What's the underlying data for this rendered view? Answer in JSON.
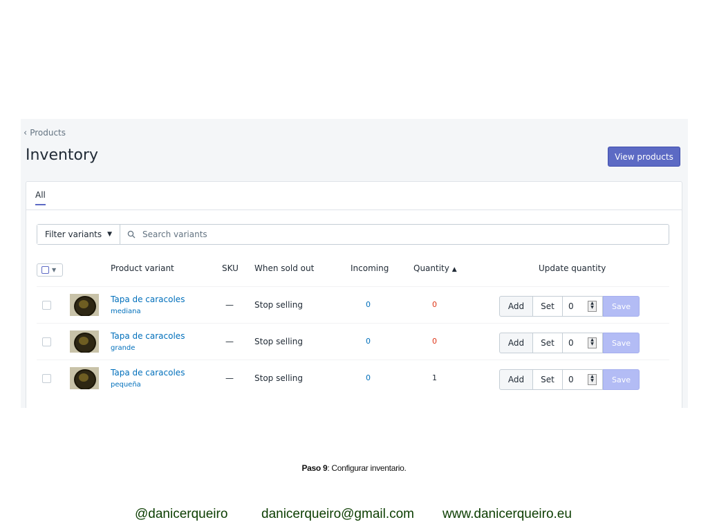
{
  "header": {
    "breadcrumb": "Products",
    "title": "Inventory",
    "view_products_label": "View products"
  },
  "tabs": [
    {
      "label": "All",
      "active": true
    }
  ],
  "filter": {
    "filter_label": "Filter variants",
    "search_placeholder": "Search variants"
  },
  "table": {
    "columns": {
      "product_variant": "Product variant",
      "sku": "SKU",
      "when_sold_out": "When sold out",
      "incoming": "Incoming",
      "quantity": "Quantity",
      "update_quantity": "Update quantity"
    },
    "rows": [
      {
        "name": "Tapa de caracoles",
        "variant": "mediana",
        "sku": "—",
        "when_sold_out": "Stop selling",
        "incoming": "0",
        "quantity": "0",
        "quantity_color": "#de3618",
        "input_value": "0"
      },
      {
        "name": "Tapa de caracoles",
        "variant": "grande",
        "sku": "—",
        "when_sold_out": "Stop selling",
        "incoming": "0",
        "quantity": "0",
        "quantity_color": "#de3618",
        "input_value": "0"
      },
      {
        "name": "Tapa de caracoles",
        "variant": "pequeña",
        "sku": "—",
        "when_sold_out": "Stop selling",
        "incoming": "0",
        "quantity": "1",
        "quantity_color": "#212b36",
        "input_value": "0"
      }
    ],
    "add_label": "Add",
    "set_label": "Set",
    "save_label": "Save"
  },
  "caption": {
    "bold": "Paso 9",
    "text": ": Configurar inventario."
  },
  "footer": {
    "handle": "@danicerqueiro",
    "email": "danicerqueiro@gmail.com",
    "website": "www.danicerqueiro.eu"
  },
  "colors": {
    "accent": "#5c6ac4",
    "link": "#006fbb",
    "zero_quantity": "#de3618"
  }
}
